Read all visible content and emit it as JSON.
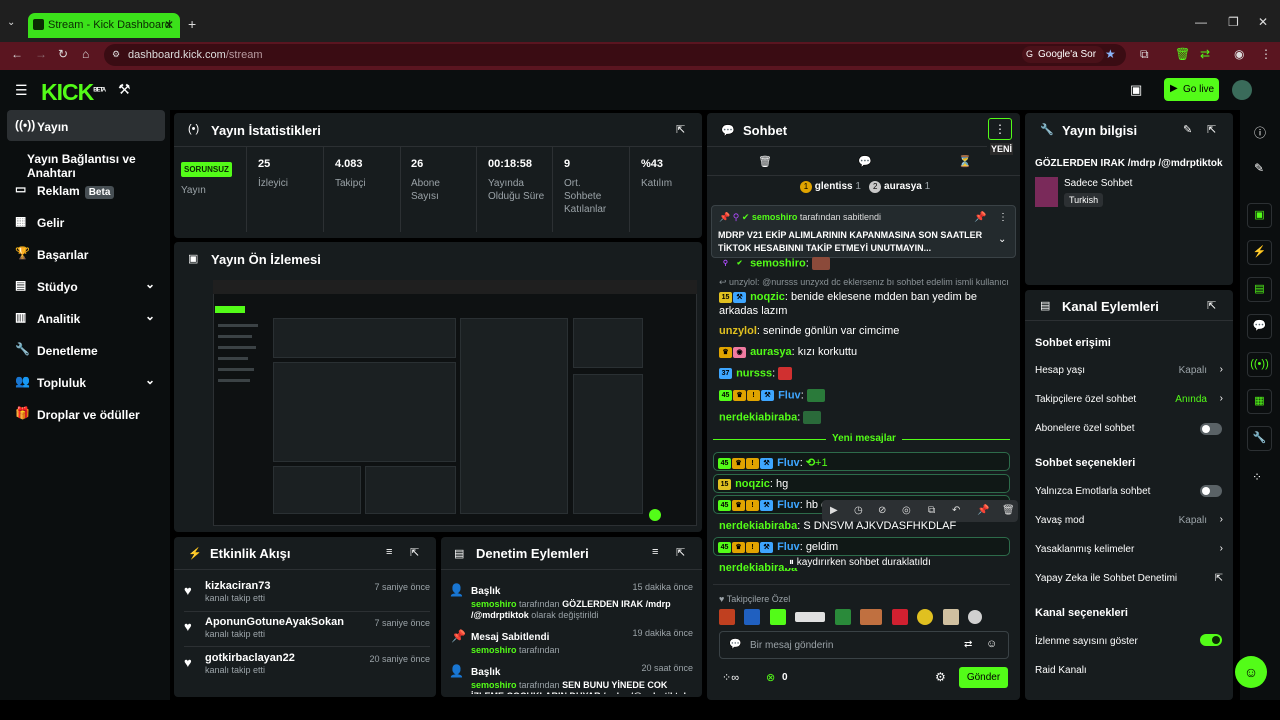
{
  "browser": {
    "tab_title": "Stream - Kick Dashboard",
    "url_host": "dashboard.kick.com",
    "url_path": "/stream",
    "search_label": "Google'a Sor"
  },
  "header": {
    "logo": "KICK",
    "beta": "BETA",
    "go_live": "Go live"
  },
  "sidebar": {
    "items": [
      {
        "label": "Yayın",
        "icon": "broadcast-icon"
      },
      {
        "label": "Yayın Bağlantısı ve Anahtarı"
      },
      {
        "label": "Reklam",
        "badge": "Beta",
        "icon": "ad-icon"
      },
      {
        "label": "Gelir",
        "icon": "revenue-icon"
      },
      {
        "label": "Başarılar",
        "icon": "trophy-icon"
      },
      {
        "label": "Stüdyo",
        "icon": "studio-icon"
      },
      {
        "label": "Analitik",
        "icon": "analytics-icon"
      },
      {
        "label": "Denetleme",
        "icon": "wrench-icon"
      },
      {
        "label": "Topluluk",
        "icon": "community-icon"
      },
      {
        "label": "Droplar ve ödüller",
        "icon": "gift-icon"
      }
    ]
  },
  "stats": {
    "title": "Yayın İstatistikleri",
    "status_badge": "SORUNSUZ",
    "status_label": "Yayın",
    "items": [
      {
        "value": "25",
        "label": "İzleyici"
      },
      {
        "value": "4.083",
        "label": "Takipçi"
      },
      {
        "value": "26",
        "label": "Abone Sayısı"
      },
      {
        "value": "00:18:58",
        "label": "Yayında Olduğu Süre"
      },
      {
        "value": "9",
        "label": "Ort. Sohbete Katılanlar"
      },
      {
        "value": "%43",
        "label": "Katılım"
      }
    ]
  },
  "preview": {
    "title": "Yayın Ön İzlemesi"
  },
  "activity": {
    "title": "Etkinlik Akışı",
    "items": [
      {
        "name": "kizkaciran73",
        "sub": "kanalı takip etti",
        "time": "7 saniye önce"
      },
      {
        "name": "AponunGotuneAyakSokan",
        "sub": "kanalı takip etti",
        "time": "7 saniye önce"
      },
      {
        "name": "gotkirbaclayan22",
        "sub": "kanalı takip etti",
        "time": "20 saniye önce"
      }
    ]
  },
  "moderation": {
    "title": "Denetim Eylemleri",
    "items": [
      {
        "title": "Başlık",
        "time": "15 dakika önce",
        "actor": "semoshiro",
        "text1": "tarafından",
        "value": "GÖZLERDEN IRAK /mdrp /@mdrptiktok",
        "text2": "olarak değiştirildi"
      },
      {
        "title": "Mesaj Sabitlendi",
        "time": "19 dakika önce",
        "actor": "semoshiro",
        "text1": "tarafından"
      },
      {
        "title": "Başlık",
        "time": "20 saat önce",
        "actor": "semoshiro",
        "text1": "tarafından",
        "value": "SEN BUNU YİNEDE COK İZLEME COCUKLARIN DUYAR /mdrp /@mdrptiktok"
      }
    ]
  },
  "chat": {
    "title": "Sohbet",
    "new_label": "YENİ",
    "top_users": [
      {
        "name": "glentiss",
        "count": "1",
        "rank": "1"
      },
      {
        "name": "aurasya",
        "count": "1",
        "rank": "2"
      }
    ],
    "pinned_by": "semoshiro",
    "pinned_suffix": "tarafından sabitlendi",
    "pinned_text": "MDRP V21 EKİP ALIMLARININ KAPANMASINA SON SAATLER TİKTOK HESABINNI TAKİP ETMEYİ UNUTMAYIN...",
    "reply_ref": "unzylol: @nursss unzyxd dc eklersenız bı sohbet edelim ismli kullanıcı...",
    "new_messages_label": "Yeni mesajlar",
    "paused_label": "kaydırırken sohbet duraklatıldı",
    "followers_only": "Takipçilere Özel",
    "input_placeholder": "Bir mesaj gönderin",
    "points": "0",
    "send": "Gönder",
    "messages": [
      {
        "user": "semoshiro",
        "text": "",
        "color": "#53fc18"
      },
      {
        "user": "noqzic",
        "text": "benide eklesene mdden ban yedim be arkadas lazım",
        "color": "#53fc18",
        "sub": "15"
      },
      {
        "user": "unzylol",
        "text": "seninde gönlün var cimcime",
        "color": "#e0c020"
      },
      {
        "user": "aurasya",
        "text": "kızı korkuttu",
        "color": "#53fc18"
      },
      {
        "user": "nursss",
        "text": "",
        "color": "#53fc18",
        "sub": "37"
      },
      {
        "user": "Fluv",
        "text": "",
        "color": "#3ea6ff",
        "sub": "45"
      },
      {
        "user": "nerdekiabiraba",
        "text": "",
        "color": "#53fc18"
      },
      {
        "user": "Fluv",
        "text": "+1",
        "color": "#3ea6ff",
        "sub": "45"
      },
      {
        "user": "noqzic",
        "text": "hg",
        "color": "#53fc18",
        "sub": "15"
      },
      {
        "user": "Fluv",
        "text": "hb c",
        "color": "#3ea6ff",
        "sub": "45"
      },
      {
        "user": "nerdekiabiraba",
        "text": "S DNSVM AJKVDASFHKDLAF",
        "color": "#53fc18"
      },
      {
        "user": "Fluv",
        "text": "geldim",
        "color": "#3ea6ff",
        "sub": "45"
      },
      {
        "user": "nerdekiabiraba",
        "text": "",
        "color": "#53fc18"
      }
    ]
  },
  "stream_info": {
    "title": "Yayın bilgisi",
    "stream_title": "GÖZLERDEN IRAK /mdrp /@mdrptiktok",
    "category": "Sadece Sohbet",
    "tag": "Turkish"
  },
  "channel_actions": {
    "title": "Kanal Eylemleri",
    "chat_access": "Sohbet erişimi",
    "account_age": "Hesap yaşı",
    "account_age_val": "Kapalı",
    "followers_chat": "Takipçilere özel sohbet",
    "followers_chat_val": "Anında",
    "subs_chat": "Abonelere özel sohbet",
    "chat_options": "Sohbet seçenekleri",
    "emotes_only": "Yalnızca Emotlarla sohbet",
    "slow_mode": "Yavaş mod",
    "slow_mode_val": "Kapalı",
    "banned_words": "Yasaklanmış kelimeler",
    "ai_moderation": "Yapay Zeka ile Sohbet Denetimi",
    "channel_options": "Kanal seçenekleri",
    "show_viewers": "İzlenme sayısını göster",
    "raid": "Raid Kanalı"
  },
  "colors": {
    "accent": "#53fc18",
    "panel": "#171c1e",
    "bg": "#0b0e0f"
  }
}
